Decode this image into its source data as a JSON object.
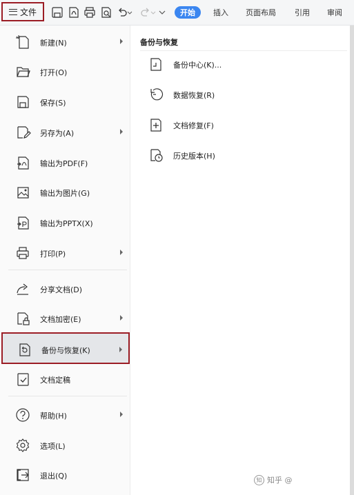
{
  "toolbar": {
    "file_label": "文件",
    "tabs": [
      "开始",
      "插入",
      "页面布局",
      "引用",
      "审阅"
    ]
  },
  "menu": {
    "items": [
      {
        "label": "新建(N)",
        "icon": "new-file-icon",
        "submenu": true
      },
      {
        "label": "打开(O)",
        "icon": "folder-open-icon",
        "submenu": false
      },
      {
        "label": "保存(S)",
        "icon": "save-icon",
        "submenu": false
      },
      {
        "label": "另存为(A)",
        "icon": "save-as-icon",
        "submenu": true
      },
      {
        "label": "输出为PDF(F)",
        "icon": "pdf-export-icon",
        "submenu": false
      },
      {
        "label": "输出为图片(G)",
        "icon": "image-export-icon",
        "submenu": false
      },
      {
        "label": "输出为PPTX(X)",
        "icon": "pptx-export-icon",
        "submenu": false
      },
      {
        "label": "打印(P)",
        "icon": "printer-icon",
        "submenu": true
      },
      {
        "label": "分享文档(D)",
        "icon": "share-icon",
        "submenu": false
      },
      {
        "label": "文档加密(E)",
        "icon": "lock-document-icon",
        "submenu": true
      },
      {
        "label": "备份与恢复(K)",
        "icon": "backup-restore-icon",
        "submenu": true,
        "selected": true
      },
      {
        "label": "文档定稿",
        "icon": "finalize-document-icon",
        "submenu": false
      },
      {
        "label": "帮助(H)",
        "icon": "help-icon",
        "submenu": true
      },
      {
        "label": "选项(L)",
        "icon": "gear-icon",
        "submenu": false
      },
      {
        "label": "退出(Q)",
        "icon": "exit-icon",
        "submenu": false
      }
    ]
  },
  "panel": {
    "title": "备份与恢复",
    "items": [
      {
        "label": "备份中心(K)...",
        "icon": "backup-center-icon"
      },
      {
        "label": "数据恢复(R)",
        "icon": "data-recovery-icon"
      },
      {
        "label": "文档修复(F)",
        "icon": "document-repair-icon"
      },
      {
        "label": "历史版本(H)",
        "icon": "history-version-icon"
      }
    ]
  },
  "watermark": "知乎 @",
  "colors": {
    "accent": "#3b86f0",
    "highlight_border": "#9b1c24",
    "selected_bg": "#e4e6e9"
  }
}
